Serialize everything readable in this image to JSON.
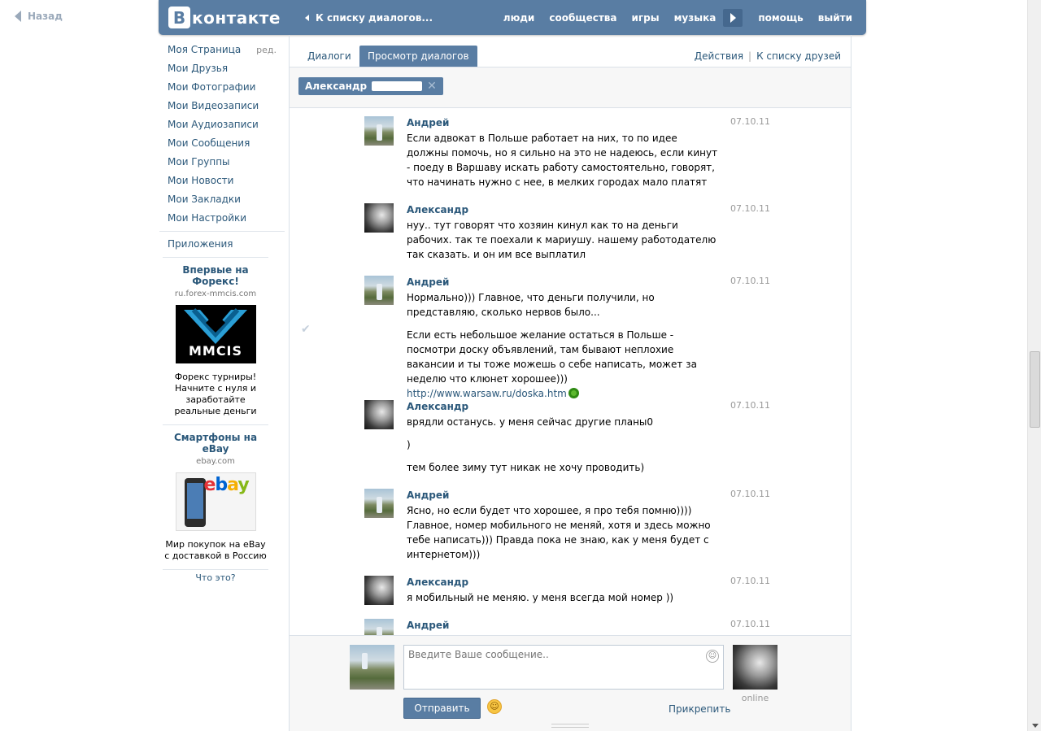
{
  "back_label": "Назад",
  "header": {
    "logo_letter": "В",
    "logo_text": "контакте",
    "back_to_dialogs": "К списку диалогов...",
    "nav": [
      "люди",
      "сообщества",
      "игры",
      "музыка",
      "помощь",
      "выйти"
    ]
  },
  "side_menu": {
    "items": [
      "Моя Страница",
      "Мои Друзья",
      "Мои Фотографии",
      "Мои Видеозаписи",
      "Мои Аудиозаписи",
      "Мои Сообщения",
      "Мои Группы",
      "Мои Новости",
      "Мои Закладки",
      "Мои Настройки"
    ],
    "edit_label": "ред.",
    "apps": "Приложения"
  },
  "ads": [
    {
      "title": "Впервые на Форекс!",
      "domain": "ru.forex-mmcis.com",
      "image_text": "MMCIS",
      "desc": "Форекс турниры! Начните с нуля и заработайте реальные деньги"
    },
    {
      "title": "Смартфоны на eBay",
      "domain": "ebay.com",
      "desc": "Мир покупок на eBay с доставкой в Россию"
    }
  ],
  "ads_what": "Что это?",
  "tabs": {
    "dialogs": "Диалоги",
    "view": "Просмотр диалогов",
    "actions": "Действия",
    "to_friends": "К списку друзей",
    "separator": "|"
  },
  "filter_token": {
    "name": "Александр"
  },
  "messages": [
    {
      "author": "Андрей",
      "date": "07.10.11",
      "avatar": "andrey",
      "paragraphs": [
        "Если адвокат в Польше работает на них, то по идее должны помочь, но я сильно на это не надеюсь, если кинут - поеду в Варшаву искать работу самостоятельно, говорят, что начинать нужно с нее, в мелких городах мало платят"
      ]
    },
    {
      "author": "Александр",
      "date": "07.10.11",
      "avatar": "alexandr",
      "paragraphs": [
        "нуу.. тут говорят что хозяин кинул как то на деньги рабочих. так те поехали к мариушу. нашему работодателю так сказать. и он им все выплатил"
      ]
    },
    {
      "author": "Андрей",
      "date": "07.10.11",
      "avatar": "andrey",
      "paragraphs": [
        "Нормально))) Главное, что деньги получили, но представляю, сколько нервов было...",
        "Если есть небольшое желание остаться в Польше - посмотри доску объявлений, там бывают неплохие вакансии и ты тоже можешь о себе написать, может за неделю что клюнет хорошее)))"
      ],
      "link": "http://www.warsaw.ru/doska.htm"
    },
    {
      "author": "Александр",
      "date": "07.10.11",
      "avatar": "alexandr",
      "paragraphs": [
        "врядли останусь. у меня сейчас другие планы0",
        ")",
        "тем более зиму тут никак не хочу проводить)"
      ]
    },
    {
      "author": "Андрей",
      "date": "07.10.11",
      "avatar": "andrey",
      "paragraphs": [
        "Ясно, но если будет что хорошее, я про тебя помню)))) Главное, номер мобильного не меняй, хотя и здесь можно тебе написать))) Правда пока не знаю, как у меня будет с интернетом)))"
      ]
    },
    {
      "author": "Александр",
      "date": "07.10.11",
      "avatar": "alexandr",
      "paragraphs": [
        "я мобильный не меняю. у меня всегда мой номер ))"
      ]
    },
    {
      "author": "Андрей",
      "date": "07.10.11",
      "avatar": "andrey",
      "paragraphs": []
    }
  ],
  "compose": {
    "placeholder": "Введите Ваше сообщение..",
    "send_label": "Отправить",
    "attach_label": "Прикрепить",
    "peer_status": "online"
  },
  "colors": {
    "brand": "#597da3",
    "link": "#2b587a",
    "muted": "#999999"
  }
}
